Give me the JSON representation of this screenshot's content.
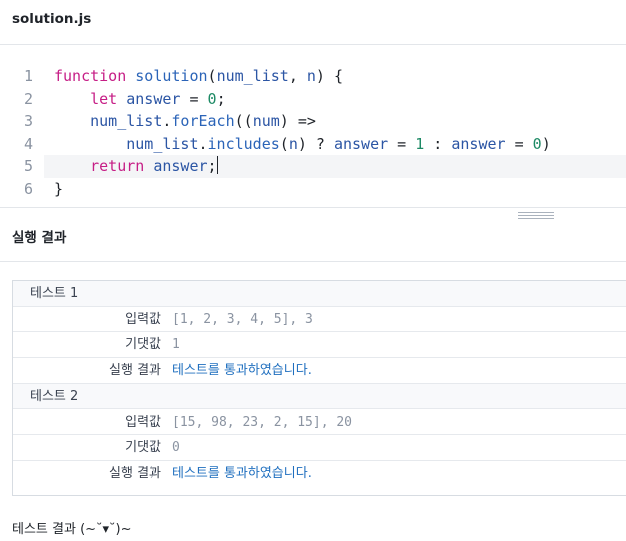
{
  "file": {
    "name": "solution.js"
  },
  "editor": {
    "lines": [
      {
        "num": "1",
        "tokens": [
          [
            "kw",
            "function"
          ],
          [
            "pl",
            " "
          ],
          [
            "fn",
            "solution"
          ],
          [
            "pl",
            "("
          ],
          [
            "id",
            "num_list"
          ],
          [
            "pl",
            ", "
          ],
          [
            "id",
            "n"
          ],
          [
            "pl",
            ") {"
          ]
        ]
      },
      {
        "num": "2",
        "tokens": [
          [
            "pl",
            "    "
          ],
          [
            "kw",
            "let"
          ],
          [
            "pl",
            " "
          ],
          [
            "id",
            "answer"
          ],
          [
            "pl",
            " = "
          ],
          [
            "num",
            "0"
          ],
          [
            "pl",
            ";"
          ]
        ]
      },
      {
        "num": "3",
        "tokens": [
          [
            "pl",
            "    "
          ],
          [
            "id",
            "num_list"
          ],
          [
            "pl",
            "."
          ],
          [
            "fn",
            "forEach"
          ],
          [
            "pl",
            "(("
          ],
          [
            "id",
            "num"
          ],
          [
            "pl",
            ") =>"
          ]
        ]
      },
      {
        "num": "4",
        "tokens": [
          [
            "pl",
            "        "
          ],
          [
            "id",
            "num_list"
          ],
          [
            "pl",
            "."
          ],
          [
            "fn",
            "includes"
          ],
          [
            "pl",
            "("
          ],
          [
            "id",
            "n"
          ],
          [
            "pl",
            ") ? "
          ],
          [
            "id",
            "answer"
          ],
          [
            "pl",
            " = "
          ],
          [
            "num",
            "1"
          ],
          [
            "pl",
            " : "
          ],
          [
            "id",
            "answer"
          ],
          [
            "pl",
            " = "
          ],
          [
            "num",
            "0"
          ],
          [
            "pl",
            ")"
          ]
        ]
      },
      {
        "num": "5",
        "tokens": [
          [
            "pl",
            "    "
          ],
          [
            "kw",
            "return"
          ],
          [
            "pl",
            " "
          ],
          [
            "id",
            "answer"
          ],
          [
            "pl",
            ";"
          ]
        ]
      },
      {
        "num": "6",
        "tokens": [
          [
            "pl",
            "}"
          ]
        ]
      }
    ]
  },
  "results": {
    "title": "실행 결과",
    "chevron": "〉",
    "tests": [
      {
        "label": "테스트 1",
        "rows": [
          {
            "label": "입력값",
            "value": "[1, 2, 3, 4, 5], 3",
            "pass": false
          },
          {
            "label": "기댓값",
            "value": "1",
            "pass": false
          },
          {
            "label": "실행 결과",
            "value": "테스트를 통과하였습니다.",
            "pass": true
          }
        ]
      },
      {
        "label": "테스트 2",
        "rows": [
          {
            "label": "입력값",
            "value": "[15, 98, 23, 2, 15], 20",
            "pass": false
          },
          {
            "label": "기댓값",
            "value": "0",
            "pass": false
          },
          {
            "label": "실행 결과",
            "value": "테스트를 통과하였습니다.",
            "pass": true
          }
        ]
      }
    ],
    "footer": "테스트 결과 (~˘▾˘)~"
  },
  "colors": {
    "keyword": "#c61e86",
    "function": "#2b64b8",
    "identifier": "#2b55a4",
    "number": "#1d8a65",
    "pass": "#1f6fbf"
  }
}
